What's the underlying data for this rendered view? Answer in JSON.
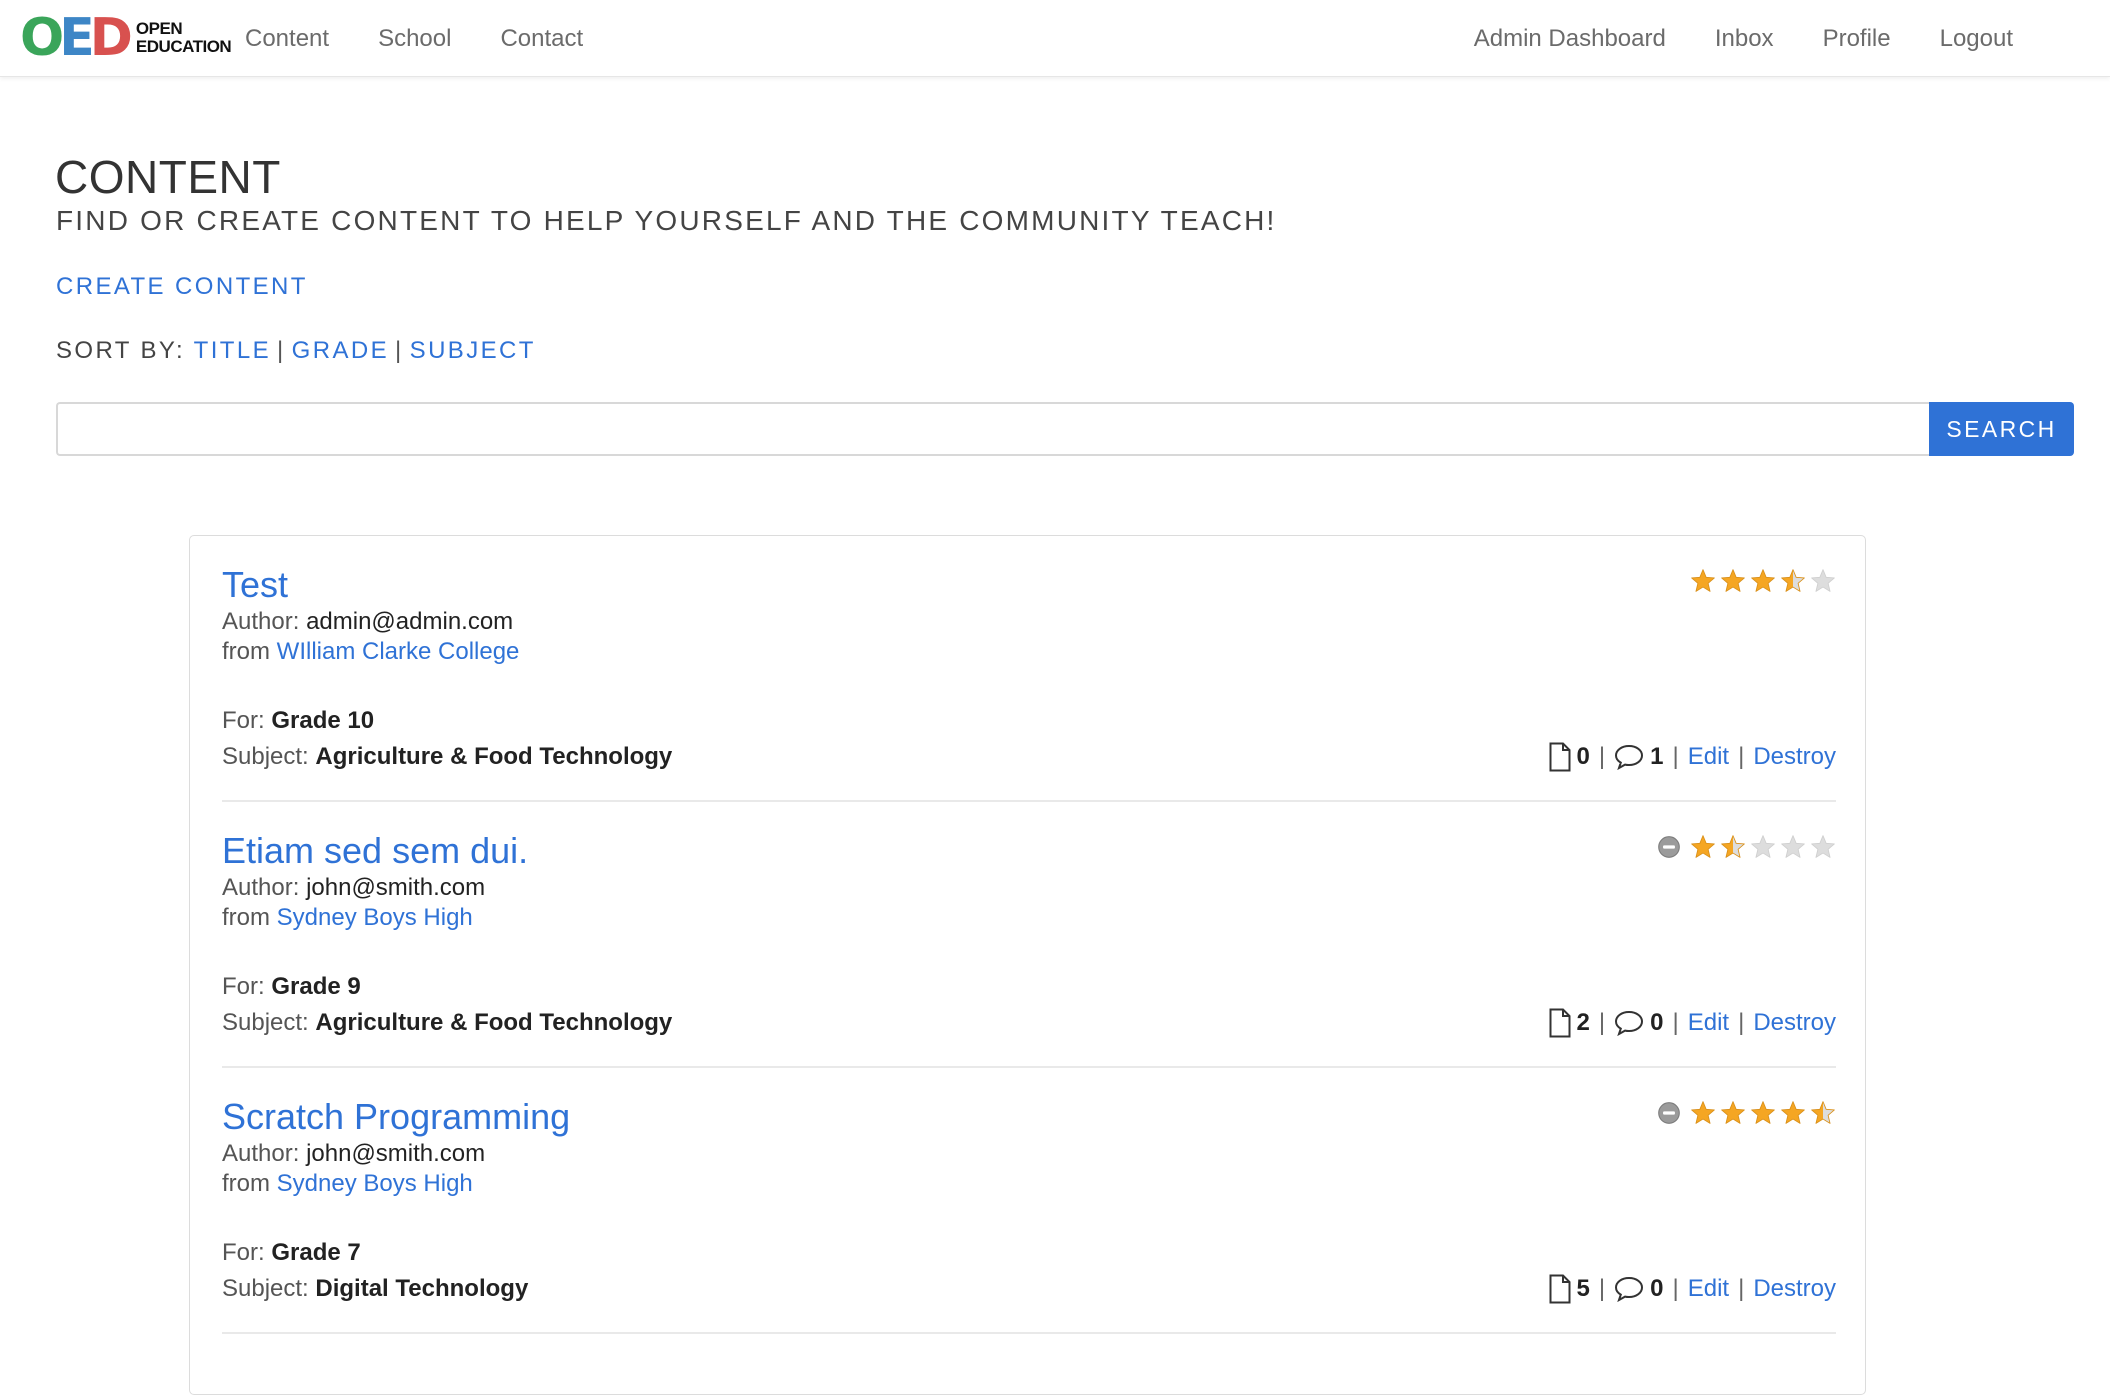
{
  "brand": {
    "logo_letters": [
      "O",
      "E",
      "D"
    ],
    "logo_line1": "OPEN",
    "logo_line2": "EDUCATION",
    "colors": {
      "o": "#3aa55a",
      "e": "#3d86c6",
      "d": "#d8514f"
    }
  },
  "nav": {
    "left": [
      {
        "label": "Content"
      },
      {
        "label": "School"
      },
      {
        "label": "Contact"
      }
    ],
    "right": [
      {
        "label": "Admin Dashboard"
      },
      {
        "label": "Inbox"
      },
      {
        "label": "Profile"
      },
      {
        "label": "Logout"
      }
    ]
  },
  "header": {
    "title": "CONTENT",
    "subtitle": "FIND OR CREATE CONTENT TO HELP YOURSELF AND THE COMMUNITY TEACH!",
    "create_link": "CREATE CONTENT"
  },
  "sort": {
    "label": "SORT BY:",
    "options": [
      "TITLE",
      "GRADE",
      "SUBJECT"
    ],
    "separator": "|"
  },
  "search": {
    "value": "",
    "placeholder": "",
    "button_label": "SEARCH"
  },
  "theme": {
    "accent": "#2f72d6",
    "star_filled": "#f5a623",
    "star_empty": "#dddddd"
  },
  "items": [
    {
      "title": "Test",
      "author_label": "Author:",
      "author": "admin@admin.com",
      "from_label": "from",
      "school": "WIlliam Clarke College",
      "for_label": "For:",
      "grade": "Grade 10",
      "subject_label": "Subject:",
      "subject": "Agriculture & Food Technology",
      "rating": 3.5,
      "rating_max": 5,
      "rating_cancel_shown": false,
      "files": "0",
      "comments": "1",
      "edit_label": "Edit",
      "destroy_label": "Destroy"
    },
    {
      "title": "Etiam sed sem dui.",
      "author_label": "Author:",
      "author": "john@smith.com",
      "from_label": "from",
      "school": "Sydney Boys High",
      "for_label": "For:",
      "grade": "Grade 9",
      "subject_label": "Subject:",
      "subject": "Agriculture & Food Technology",
      "rating": 1.5,
      "rating_max": 5,
      "rating_cancel_shown": true,
      "files": "2",
      "comments": "0",
      "edit_label": "Edit",
      "destroy_label": "Destroy"
    },
    {
      "title": "Scratch Programming",
      "author_label": "Author:",
      "author": "john@smith.com",
      "from_label": "from",
      "school": "Sydney Boys High",
      "for_label": "For:",
      "grade": "Grade 7",
      "subject_label": "Subject:",
      "subject": "Digital Technology",
      "rating": 4.5,
      "rating_max": 5,
      "rating_cancel_shown": true,
      "files": "5",
      "comments": "0",
      "edit_label": "Edit",
      "destroy_label": "Destroy"
    }
  ]
}
